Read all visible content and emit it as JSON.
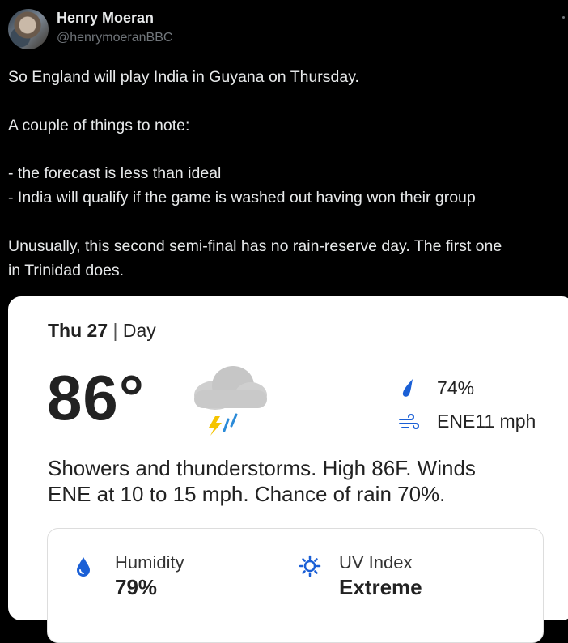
{
  "author": {
    "name": "Henry Moeran",
    "handle": "@henrymoeranBBC"
  },
  "tweet": {
    "lines": [
      "So England will play India in Guyana on Thursday.",
      "A couple of things to note:",
      "- the forecast is less than ideal",
      "- India will qualify if the game is washed out having won their group",
      "Unusually, this second semi-final has no rain-reserve day. The first one",
      "in Trinidad does."
    ]
  },
  "weather": {
    "day": "Thu 27",
    "separator": "|",
    "period": "Day",
    "temperature": "86°",
    "rain_chance": "74%",
    "wind": "ENE11 mph",
    "description_line1": "Showers and thunderstorms. High 86F. Winds",
    "description_line2": "ENE at 10 to 15 mph. Chance of rain 70%.",
    "humidity_label": "Humidity",
    "humidity_value": "79%",
    "uv_label": "UV Index",
    "uv_value": "Extreme",
    "icons": {
      "condition": "thunderstorm-cloud-icon",
      "rain": "raindrop-icon",
      "wind": "wind-icon",
      "humidity": "humidity-drop-icon",
      "uv": "sun-icon"
    },
    "colors": {
      "accent": "#1a5fd6",
      "bolt": "#f5c400",
      "cloud": "#c8c8c8"
    }
  }
}
